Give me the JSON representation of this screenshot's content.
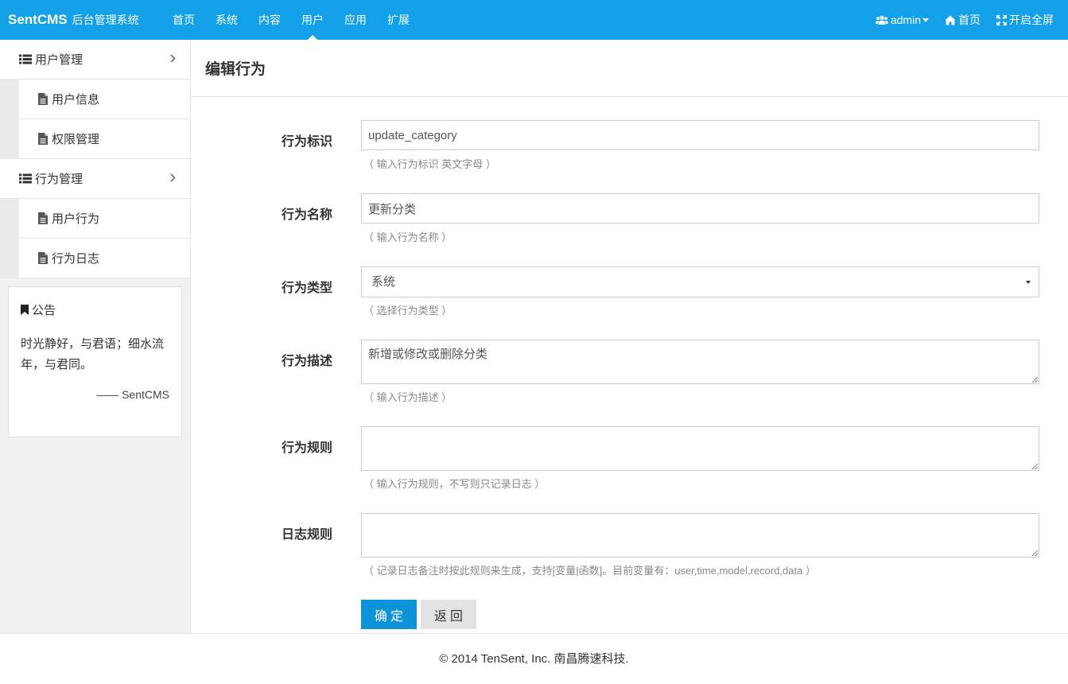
{
  "brand": {
    "name": "SentCMS",
    "subtitle": "后台管理系统"
  },
  "nav": {
    "items": [
      {
        "label": "首页"
      },
      {
        "label": "系统"
      },
      {
        "label": "内容"
      },
      {
        "label": "用户",
        "active": true
      },
      {
        "label": "应用"
      },
      {
        "label": "扩展"
      }
    ],
    "right": {
      "user": "admin",
      "home": "首页",
      "fullscreen": "开启全屏"
    }
  },
  "sidebar": {
    "groups": [
      {
        "label": "用户管理",
        "items": [
          {
            "label": "用户信息"
          },
          {
            "label": "权限管理"
          }
        ]
      },
      {
        "label": "行为管理",
        "items": [
          {
            "label": "用户行为"
          },
          {
            "label": "行为日志"
          }
        ]
      }
    ],
    "notice": {
      "title": "公告",
      "text": "时光静好，与君语；细水流年，与君同。",
      "signature": "—— SentCMS"
    }
  },
  "page": {
    "title": "编辑行为"
  },
  "form": {
    "name": {
      "label": "行为标识",
      "value": "update_category",
      "help": "（ 输入行为标识 英文字母 ）"
    },
    "title": {
      "label": "行为名称",
      "value": "更新分类",
      "help": "（ 输入行为名称 ）"
    },
    "type": {
      "label": "行为类型",
      "value": "系统",
      "help": "（ 选择行为类型 ）"
    },
    "remark": {
      "label": "行为描述",
      "value": "新增或修改或删除分类",
      "help": "（ 输入行为描述 ）"
    },
    "rule": {
      "label": "行为规则",
      "value": "",
      "help": "（ 输入行为规则，不写则只记录日志 ）"
    },
    "log": {
      "label": "日志规则",
      "value": "",
      "help": "（ 记录日志备注时按此规则来生成，支持[变量|函数]。目前变量有：user,time,model,record,data ）"
    },
    "submit_label": "确定",
    "back_label": "返回"
  },
  "footer": {
    "text": "© 2014 TenSent, Inc. 南昌腾速科技."
  },
  "colors": {
    "topbar": "#12a0e8",
    "primary_button": "#0f93d8",
    "secondary_button": "#e3e3e3"
  },
  "icons": [
    "users-icon",
    "home-icon",
    "fullscreen-icon",
    "list-icon",
    "file-icon",
    "chevron-right-icon",
    "bookmark-icon",
    "caret-down-icon"
  ]
}
